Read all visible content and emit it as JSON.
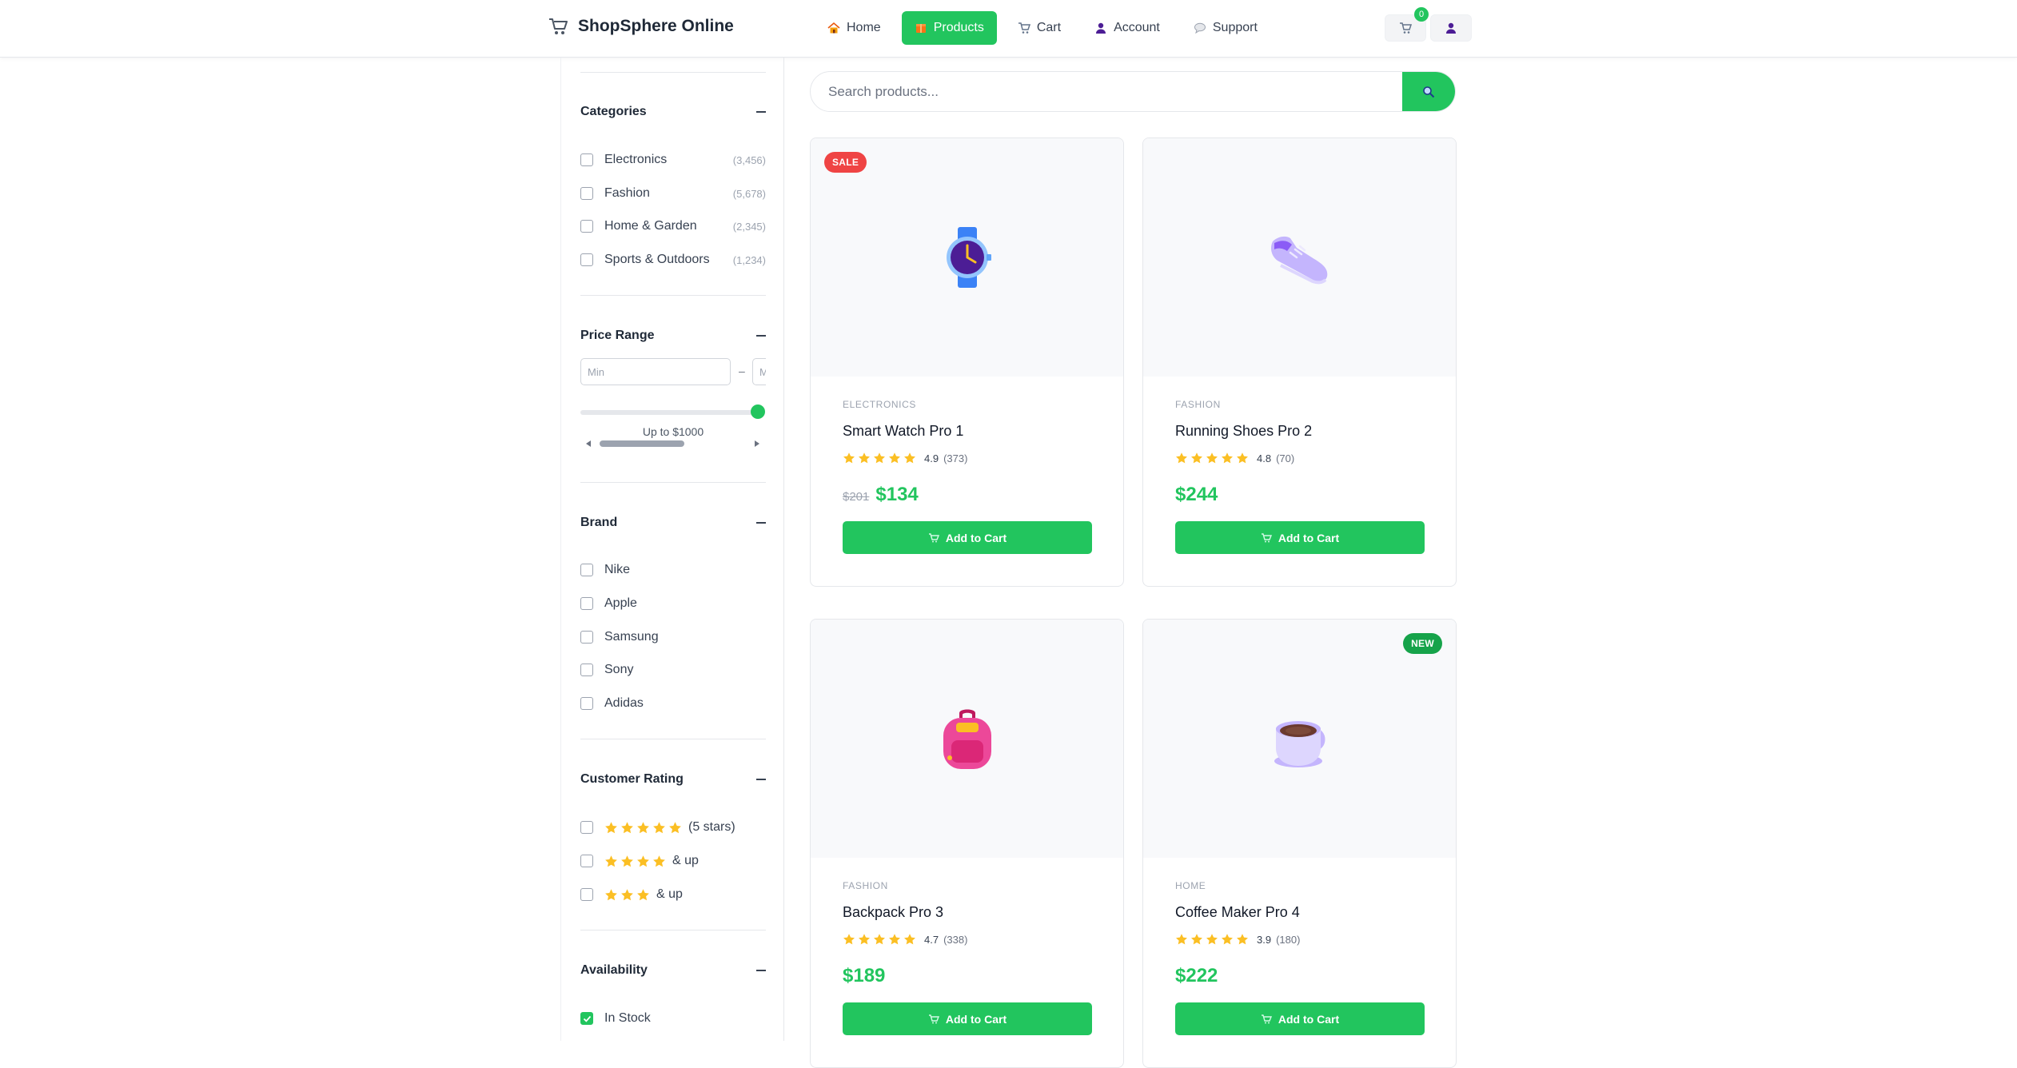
{
  "header": {
    "brand": "ShopSphere Online",
    "nav": [
      {
        "label": "Home",
        "icon": "house-icon"
      },
      {
        "label": "Products",
        "icon": "package-icon",
        "active": true
      },
      {
        "label": "Cart",
        "icon": "cart-icon"
      },
      {
        "label": "Account",
        "icon": "user-icon"
      },
      {
        "label": "Support",
        "icon": "chat-bubble-icon"
      }
    ],
    "cart_count": "0"
  },
  "sidebar": {
    "categories": {
      "title": "Categories",
      "items": [
        {
          "label": "Electronics",
          "count": "(3,456)"
        },
        {
          "label": "Fashion",
          "count": "(5,678)"
        },
        {
          "label": "Home & Garden",
          "count": "(2,345)"
        },
        {
          "label": "Sports & Outdoors",
          "count": "(1,234)"
        }
      ]
    },
    "price": {
      "title": "Price Range",
      "min_placeholder": "Min",
      "max_placeholder": "Max",
      "dash": "–",
      "slider_label": "Up to $1000",
      "slider_value": 1000,
      "slider_max": 1000
    },
    "brand": {
      "title": "Brand",
      "items": [
        "Nike",
        "Apple",
        "Samsung",
        "Sony",
        "Adidas"
      ]
    },
    "rating": {
      "title": "Customer Rating",
      "items": [
        {
          "stars": 5,
          "label": "(5 stars)"
        },
        {
          "stars": 4,
          "label": "& up"
        },
        {
          "stars": 3,
          "label": "& up"
        }
      ]
    },
    "availability": {
      "title": "Availability",
      "items": [
        {
          "label": "In Stock",
          "checked": true
        }
      ]
    }
  },
  "search": {
    "placeholder": "Search products..."
  },
  "products": [
    {
      "category": "ELECTRONICS",
      "name": "Smart Watch Pro 1",
      "rating": "4.9",
      "reviews": "(373)",
      "old_price": "$201",
      "price": "$134",
      "tag": "SALE",
      "icon": "watch-icon",
      "cta": "Add to Cart"
    },
    {
      "category": "FASHION",
      "name": "Running Shoes Pro 2",
      "rating": "4.8",
      "reviews": "(70)",
      "old_price": "",
      "price": "$244",
      "tag": "",
      "icon": "shoe-icon",
      "cta": "Add to Cart"
    },
    {
      "category": "FASHION",
      "name": "Backpack Pro 3",
      "rating": "4.7",
      "reviews": "(338)",
      "old_price": "",
      "price": "$189",
      "tag": "",
      "icon": "backpack-icon",
      "cta": "Add to Cart"
    },
    {
      "category": "HOME",
      "name": "Coffee Maker Pro 4",
      "rating": "3.9",
      "reviews": "(180)",
      "old_price": "",
      "price": "$222",
      "tag": "NEW",
      "icon": "coffee-mug-icon",
      "cta": "Add to Cart"
    }
  ],
  "colors": {
    "accent": "#22c55e",
    "sale": "#ef4444",
    "new": "#16a34a",
    "star": "#fbbf24"
  }
}
